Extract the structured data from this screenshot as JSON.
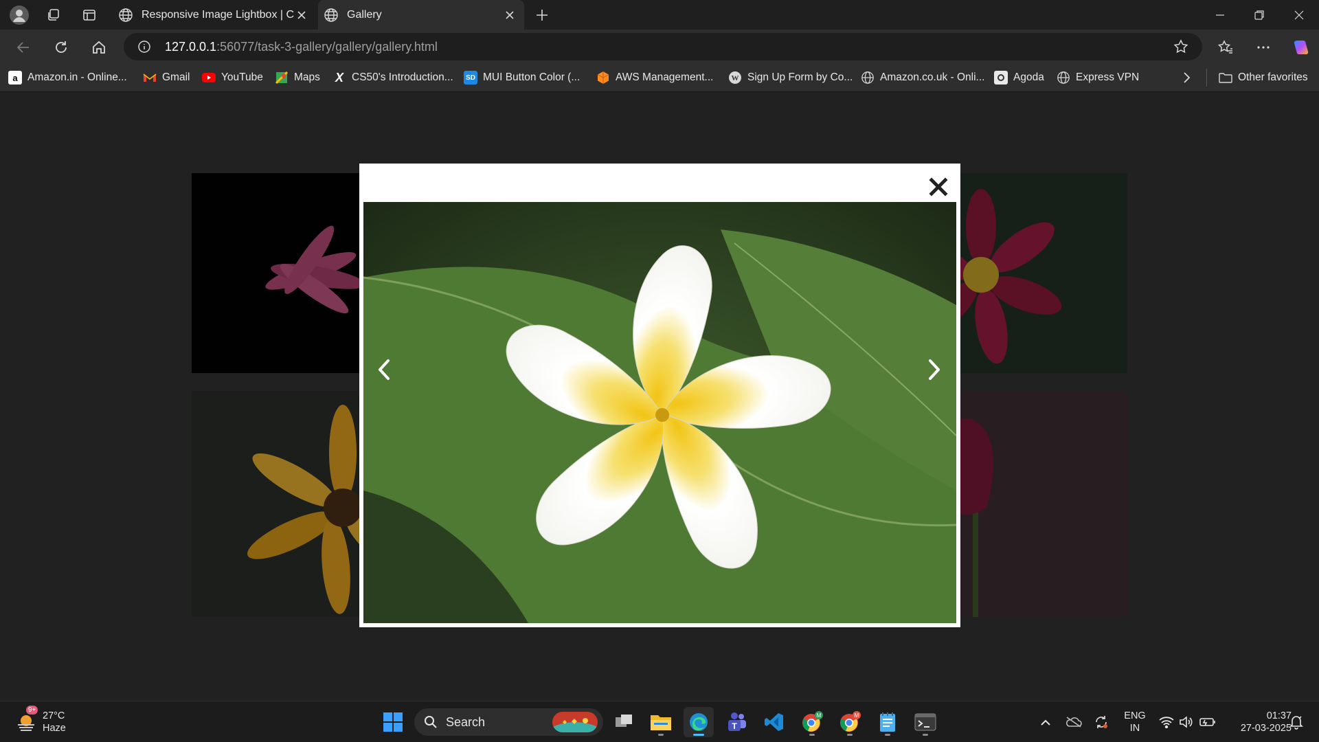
{
  "browser": {
    "tabs": [
      {
        "title": "Responsive Image Lightbox | Codi",
        "active": false
      },
      {
        "title": "Gallery",
        "active": true
      }
    ],
    "url_host": "127.0.0.1",
    "url_rest": ":56077/task-3-gallery/gallery/gallery.html",
    "bookmarks": [
      {
        "label": "Amazon.in - Online...",
        "icon": "amazon-icon"
      },
      {
        "label": "Gmail",
        "icon": "gmail-icon"
      },
      {
        "label": "YouTube",
        "icon": "youtube-icon"
      },
      {
        "label": "Maps",
        "icon": "maps-icon"
      },
      {
        "label": "CS50's Introduction...",
        "icon": "x-icon"
      },
      {
        "label": "MUI Button Color (...",
        "icon": "sd-icon"
      },
      {
        "label": "AWS Management...",
        "icon": "aws-icon"
      },
      {
        "label": "Sign Up Form by Co...",
        "icon": "wordpress-icon"
      },
      {
        "label": "Amazon.co.uk - Onli...",
        "icon": "globe-icon"
      },
      {
        "label": "Agoda",
        "icon": "agoda-icon"
      },
      {
        "label": "Express VPN",
        "icon": "globe-icon"
      }
    ],
    "other_favorites": "Other favorites"
  },
  "gallery": {
    "thumbnails": [
      "pink-daisy",
      "red-dahlia",
      "yellow-daisy",
      "tulip"
    ]
  },
  "lightbox": {
    "image": "white-plumeria-flower"
  },
  "taskbar": {
    "weather_temp": "27°C",
    "weather_desc": "Haze",
    "weather_badge": "9+",
    "search_label": "Search",
    "lang1": "ENG",
    "lang2": "IN",
    "time": "01:37",
    "date": "27-03-2025"
  },
  "colors": {
    "accent": "#4cc2ff",
    "page_bg": "#333333",
    "tab_active": "#2e2e2e"
  }
}
